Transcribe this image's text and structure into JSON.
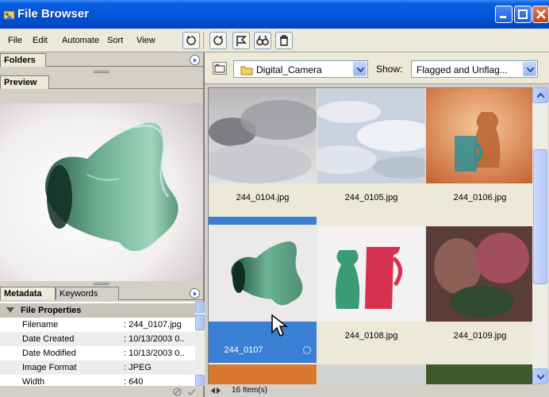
{
  "window": {
    "title": "File Browser"
  },
  "menu": [
    "File",
    "Edit",
    "Automate",
    "Sort",
    "View"
  ],
  "left_panel": {
    "top_tabs": {
      "folders": "Folders",
      "preview": "Preview"
    },
    "bottom_tabs": {
      "metadata": "Metadata",
      "keywords": "Keywords"
    },
    "metadata": {
      "section": "File Properties",
      "rows": [
        {
          "key": "Filename",
          "value": ": 244_0107.jpg"
        },
        {
          "key": "Date Created",
          "value": ": 10/13/2003 0.."
        },
        {
          "key": "Date Modified",
          "value": ": 10/13/2003 0.."
        },
        {
          "key": "Image Format",
          "value": ": JPEG"
        },
        {
          "key": "Width",
          "value": ": 640"
        }
      ]
    }
  },
  "path_bar": {
    "folder": "Digital_Camera",
    "show_label": "Show:",
    "show_value": "Flagged and Unflag..."
  },
  "thumbnails": [
    {
      "name": "244_0104.jpg"
    },
    {
      "name": "244_0105.jpg"
    },
    {
      "name": "244_0106.jpg"
    },
    {
      "name": "244_0107",
      "selected": true
    },
    {
      "name": "244_0108.jpg"
    },
    {
      "name": "244_0109.jpg"
    }
  ],
  "status": {
    "items": "16 Item(s)"
  },
  "colors": {
    "titlebar": "#0053d6",
    "selection": "#3b7fd4",
    "panel": "#d4d0c8"
  }
}
